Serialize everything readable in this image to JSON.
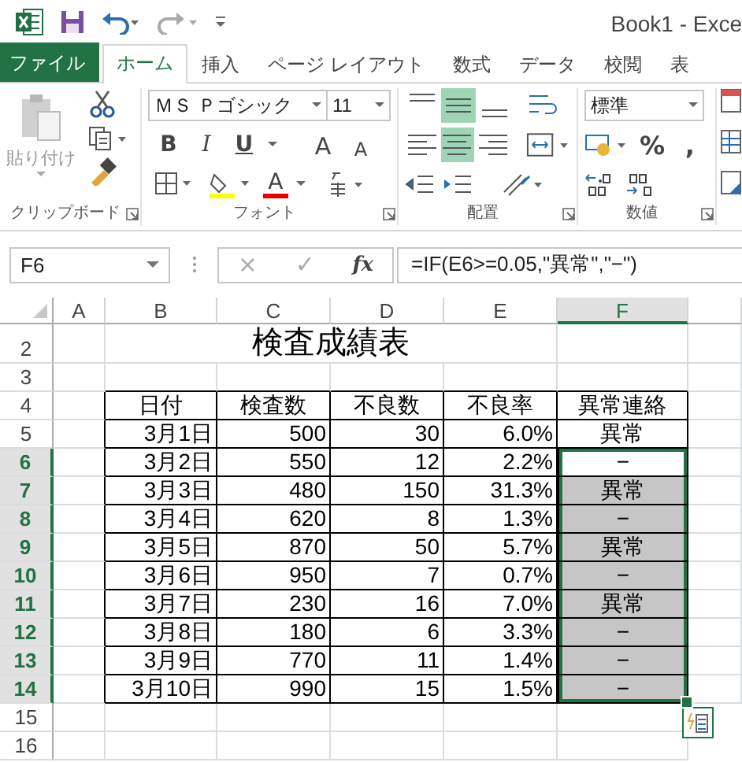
{
  "title_bar": {
    "title": "Book1 - Exce"
  },
  "tabs": [
    {
      "label": "ファイル",
      "kind": "file",
      "selected": false
    },
    {
      "label": "ホーム",
      "kind": "tab",
      "selected": true
    },
    {
      "label": "挿入",
      "kind": "tab",
      "selected": false
    },
    {
      "label": "ページ レイアウト",
      "kind": "tab",
      "selected": false
    },
    {
      "label": "数式",
      "kind": "tab",
      "selected": false
    },
    {
      "label": "データ",
      "kind": "tab",
      "selected": false
    },
    {
      "label": "校閲",
      "kind": "tab",
      "selected": false
    },
    {
      "label": "表",
      "kind": "tab",
      "selected": false
    }
  ],
  "ribbon": {
    "clipboard": {
      "paste": "貼り付け",
      "label": "クリップボード"
    },
    "font": {
      "name": "ＭＳ Ｐゴシック",
      "size": "11",
      "bold": "B",
      "italic": "I",
      "underline": "U",
      "grow": "A",
      "shrink": "A",
      "font_color": "A",
      "label": "フォント"
    },
    "alignment": {
      "buttons": [
        {
          "kind": "top",
          "selected": false
        },
        {
          "kind": "middle",
          "selected": true
        },
        {
          "kind": "bottom",
          "selected": false
        },
        {
          "kind": "left",
          "selected": false
        },
        {
          "kind": "center",
          "selected": true
        },
        {
          "kind": "right",
          "selected": false
        }
      ],
      "label": "配置"
    },
    "number": {
      "format": "標準",
      "percent": "%",
      "comma": ",",
      "label": "数値"
    }
  },
  "formula_bar": {
    "name_box": "F6",
    "cancel": "×",
    "enter": "✓",
    "function": "fx",
    "formula": "=IF(E6>=0.05,\"異常\",\"−\")"
  },
  "sheet": {
    "columns": [
      {
        "label": "A",
        "selected": false
      },
      {
        "label": "B",
        "selected": false
      },
      {
        "label": "C",
        "selected": false
      },
      {
        "label": "D",
        "selected": false
      },
      {
        "label": "E",
        "selected": false
      },
      {
        "label": "F",
        "selected": true
      }
    ],
    "rows": [
      {
        "number": "2",
        "selected": false
      },
      {
        "number": "3",
        "selected": false
      },
      {
        "number": "4",
        "selected": false
      },
      {
        "number": "5",
        "selected": false
      },
      {
        "number": "6",
        "selected": true
      },
      {
        "number": "7",
        "selected": true
      },
      {
        "number": "8",
        "selected": true
      },
      {
        "number": "9",
        "selected": true
      },
      {
        "number": "10",
        "selected": true
      },
      {
        "number": "11",
        "selected": true
      },
      {
        "number": "12",
        "selected": true
      },
      {
        "number": "13",
        "selected": true
      },
      {
        "number": "14",
        "selected": true
      },
      {
        "number": "15",
        "selected": false
      },
      {
        "number": "16",
        "selected": false
      }
    ],
    "title": "検査成績表",
    "table": {
      "columns": [
        "日付",
        "検査数",
        "不良数",
        "不良率",
        "異常連絡"
      ],
      "rows": [
        {
          "cells": [
            "3月1日",
            "500",
            "30",
            "6.0%",
            "異常"
          ],
          "selected": false,
          "active": false
        },
        {
          "cells": [
            "3月2日",
            "550",
            "12",
            "2.2%",
            "−"
          ],
          "selected": true,
          "active": true
        },
        {
          "cells": [
            "3月3日",
            "480",
            "150",
            "31.3%",
            "異常"
          ],
          "selected": true,
          "active": false
        },
        {
          "cells": [
            "3月4日",
            "620",
            "8",
            "1.3%",
            "−"
          ],
          "selected": true,
          "active": false
        },
        {
          "cells": [
            "3月5日",
            "870",
            "50",
            "5.7%",
            "異常"
          ],
          "selected": true,
          "active": false
        },
        {
          "cells": [
            "3月6日",
            "950",
            "7",
            "0.7%",
            "−"
          ],
          "selected": true,
          "active": false
        },
        {
          "cells": [
            "3月7日",
            "230",
            "16",
            "7.0%",
            "異常"
          ],
          "selected": true,
          "active": false
        },
        {
          "cells": [
            "3月8日",
            "180",
            "6",
            "3.3%",
            "−"
          ],
          "selected": true,
          "active": false
        },
        {
          "cells": [
            "3月9日",
            "770",
            "11",
            "1.4%",
            "−"
          ],
          "selected": true,
          "active": false
        },
        {
          "cells": [
            "3月10日",
            "990",
            "15",
            "1.5%",
            "−"
          ],
          "selected": true,
          "active": false
        }
      ]
    }
  }
}
